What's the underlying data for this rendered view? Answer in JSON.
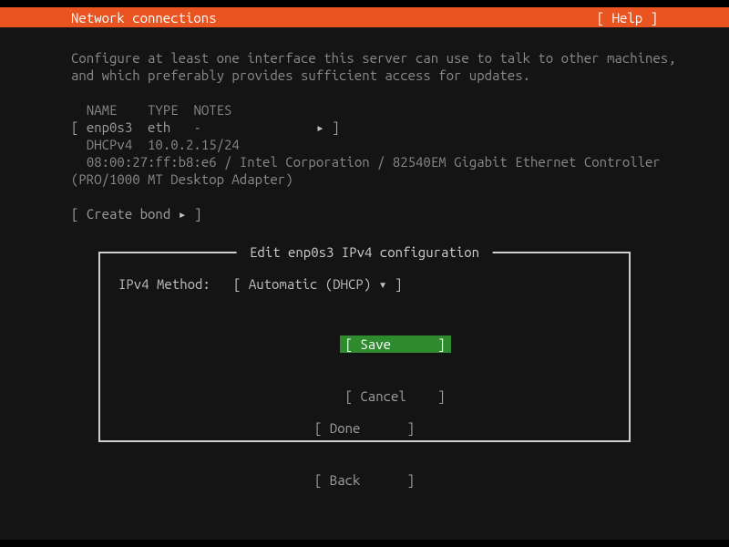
{
  "header": {
    "title": "Network connections",
    "help": "[ Help ]"
  },
  "intro": {
    "line1": "Configure at least one interface this server can use to talk to other machines,",
    "line2": "and which preferably provides sufficient access for updates."
  },
  "table": {
    "hdr_name": "NAME",
    "hdr_type": "TYPE",
    "hdr_notes": "NOTES",
    "row_open": "[",
    "row_close": "]",
    "iface_name": "enp0s3",
    "iface_type": "eth",
    "iface_notes": "-",
    "arrow": "▸",
    "dhcp_label": "DHCPv4",
    "dhcp_addr": "10.0.2.15/24",
    "hw_line": "08:00:27:ff:b8:e6 / Intel Corporation / 82540EM Gigabit Ethernet Controller",
    "hw_line2": "(PRO/1000 MT Desktop Adapter)"
  },
  "create_bond": {
    "open": "[",
    "label": "Create bond",
    "arrow": "▸",
    "close": "]"
  },
  "dialog": {
    "title": " Edit enp0s3 IPv4 configuration ",
    "method_label": "IPv4 Method:",
    "method_open": "[",
    "method_value": "Automatic (DHCP)",
    "method_caret": "▾",
    "method_close": "]",
    "save_open": "[",
    "save_label": "Save",
    "save_close": "]",
    "cancel_open": "[",
    "cancel_label": "Cancel",
    "cancel_close": "]"
  },
  "footer": {
    "done_open": "[",
    "done_label": "Done",
    "done_close": "]",
    "back_open": "[",
    "back_label": "Back",
    "back_close": "]"
  }
}
